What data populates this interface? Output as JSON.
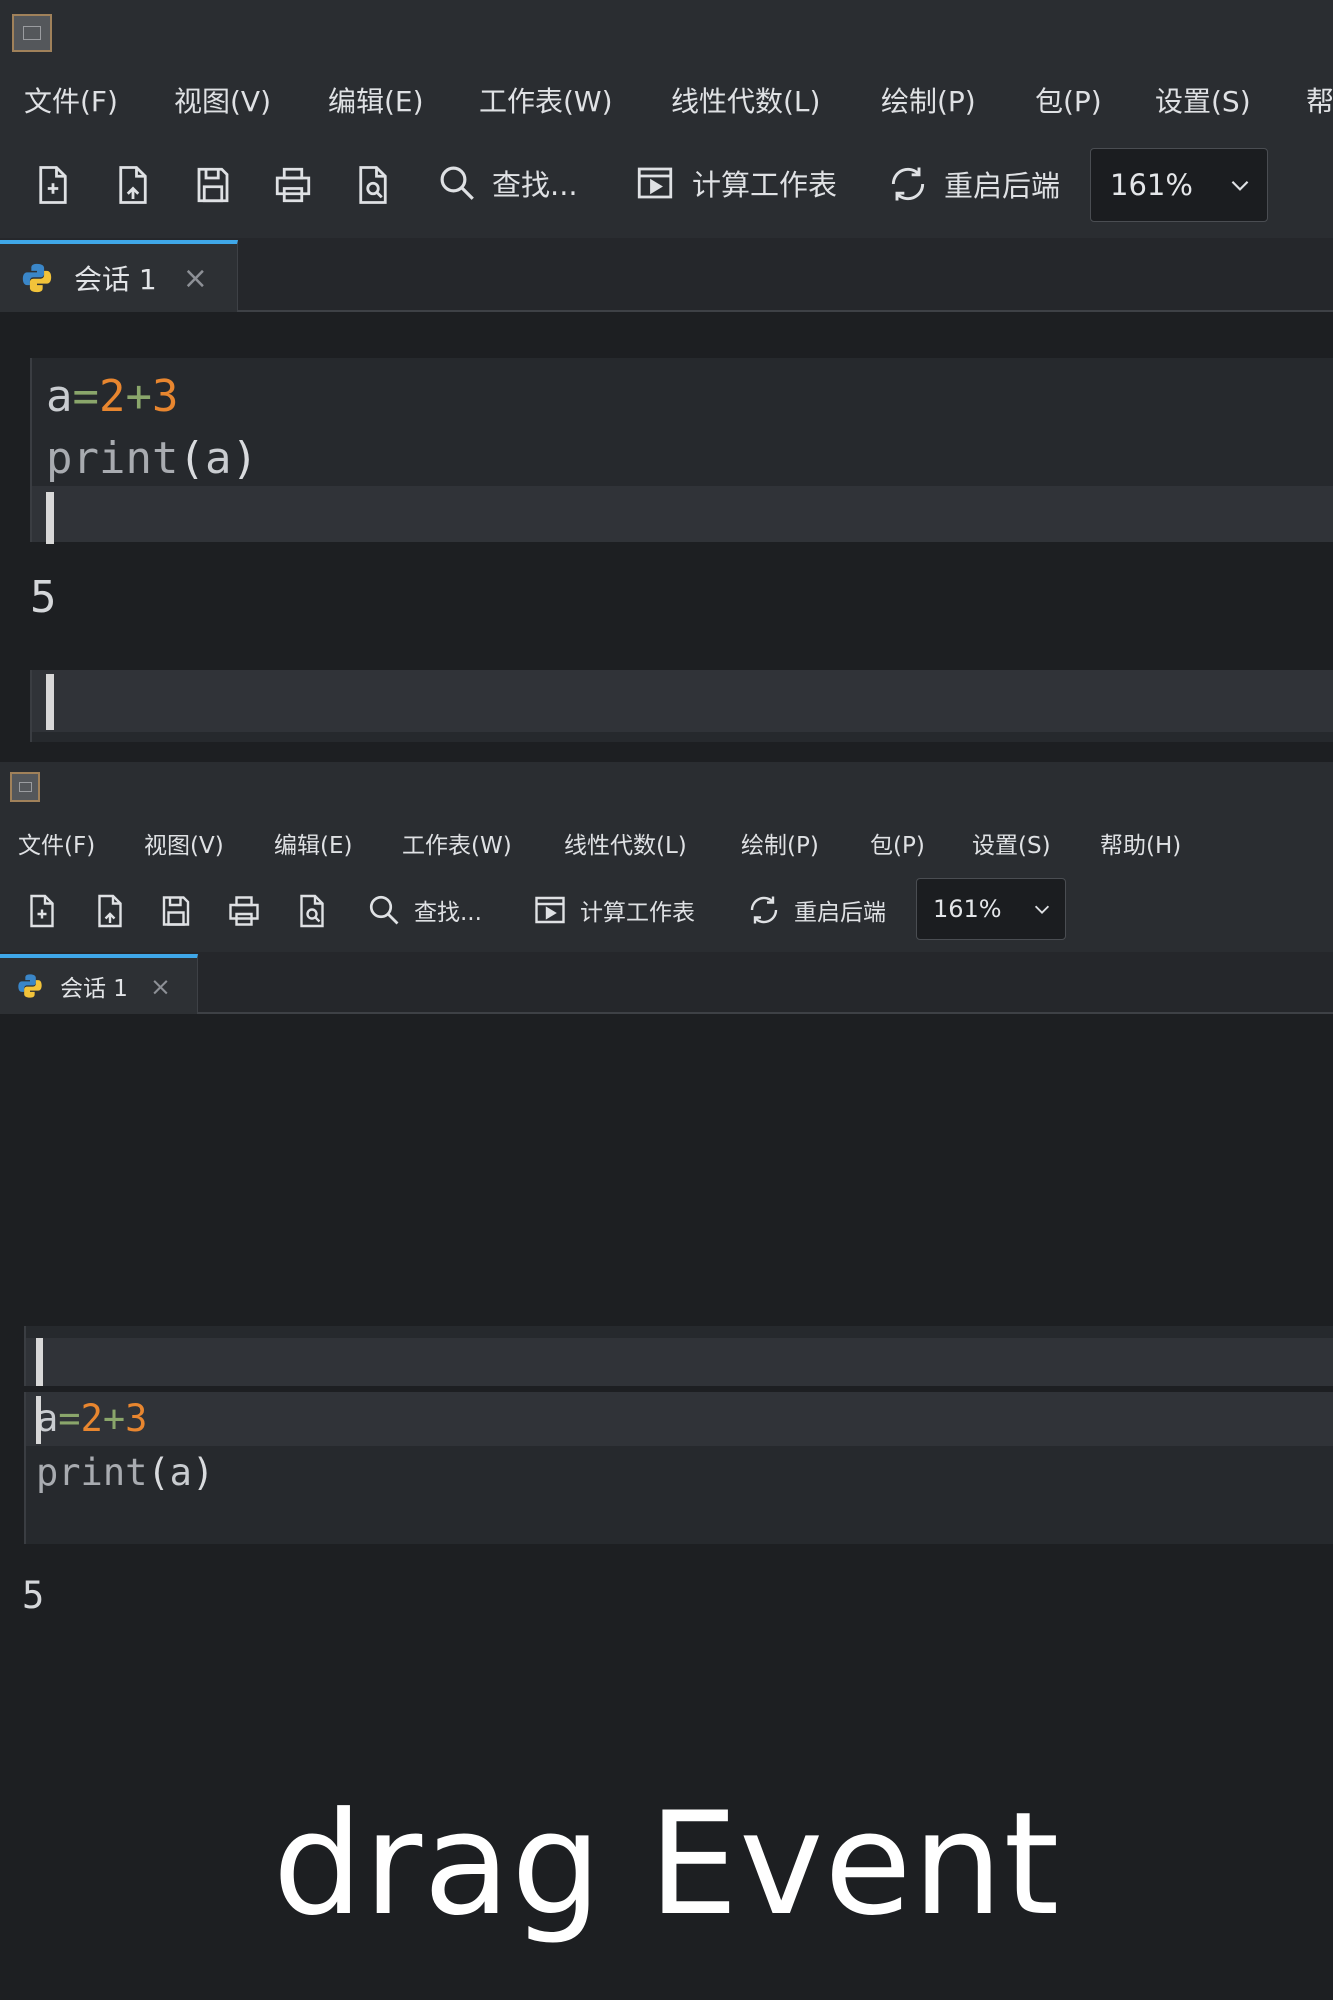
{
  "menu": [
    "文件(F)",
    "视图(V)",
    "编辑(E)",
    "工作表(W)",
    "线性代数(L)",
    "绘制(P)",
    "包(P)",
    "设置(S)",
    "帮助(H)"
  ],
  "toolbar": {
    "find_label": "查找...",
    "compute_label": "计算工作表",
    "restart_label": "重启后端",
    "zoom_value": "161%"
  },
  "tab": {
    "label": "会话 1",
    "close": "×"
  },
  "cells": {
    "line1": {
      "var": "a",
      "op1": "=",
      "n1": "2",
      "op2": "+",
      "n2": "3"
    },
    "line2": {
      "fn": "print",
      "open": "(",
      "arg": "a",
      "close": ")"
    },
    "output": "5"
  },
  "caption": "drag Event",
  "colors": {
    "accent": "#3fa7e8",
    "number": "#e8862f",
    "operator": "#8aa66b",
    "background": "#1d1f22"
  },
  "icons": [
    "app-icon",
    "new-file-icon",
    "open-file-icon",
    "save-icon",
    "print-icon",
    "print-preview-icon",
    "search-icon",
    "compute-icon",
    "restart-icon",
    "chevron-down-icon",
    "python-icon",
    "close-icon"
  ]
}
